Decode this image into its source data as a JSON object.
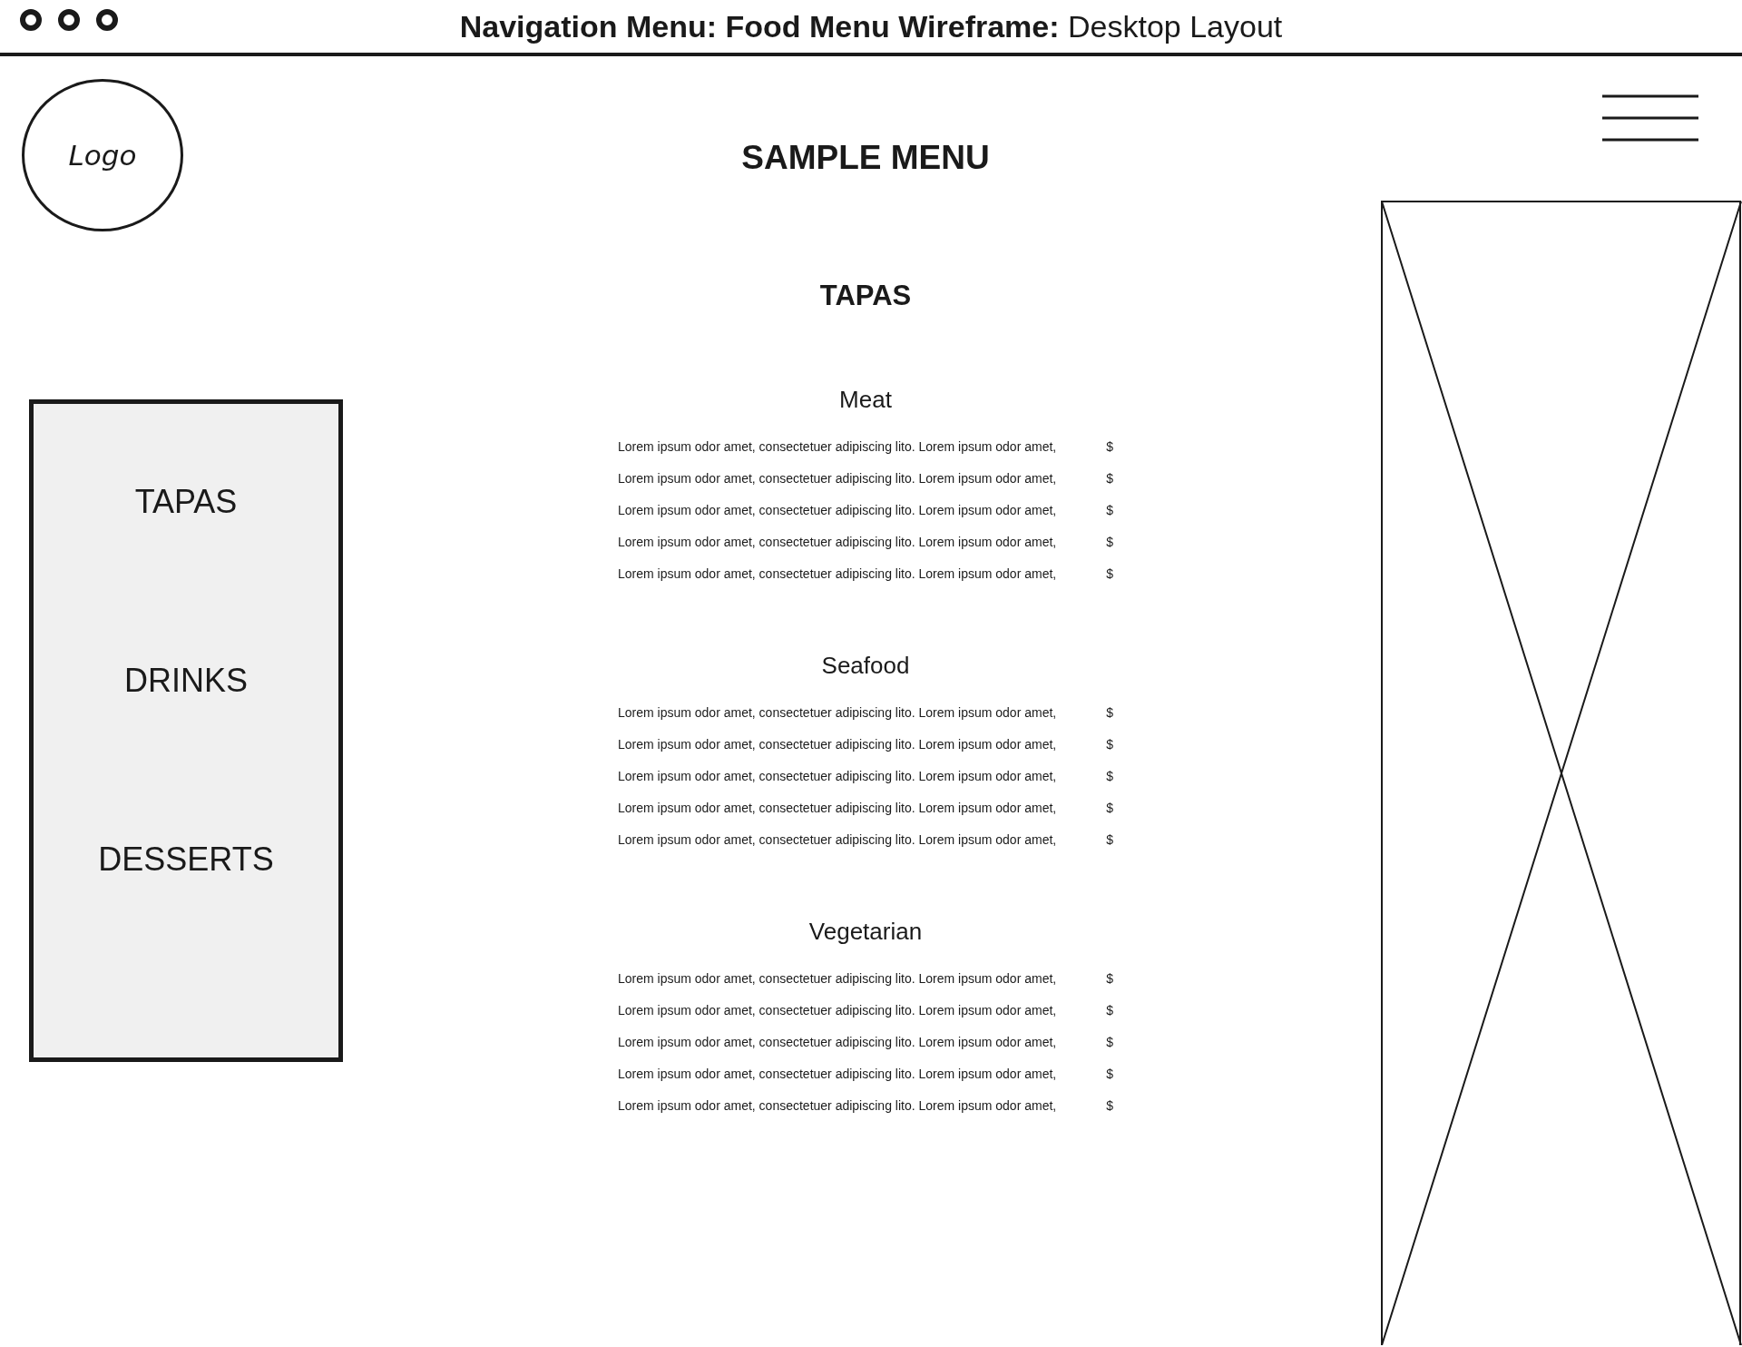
{
  "window": {
    "title": "**Navigation Menu: Food Menu Wireframe:** Desktop Layout"
  },
  "header": {
    "logo": "Logo",
    "heading": "SAMPLE MENU"
  },
  "nav": {
    "items": [
      "TAPAS",
      "DRINKS",
      "DESSERTS"
    ]
  },
  "menu": {
    "title": "TAPAS",
    "sections": [
      {
        "name": "Meat",
        "items": [
          {
            "description": "Lorem ipsum odor amet, consectetuer adipiscing lito. Lorem ipsum odor amet,",
            "price": "$"
          },
          {
            "description": "Lorem ipsum odor amet, consectetuer adipiscing lito. Lorem ipsum odor amet,",
            "price": "$"
          },
          {
            "description": "Lorem ipsum odor amet, consectetuer adipiscing lito. Lorem ipsum odor amet,",
            "price": "$"
          },
          {
            "description": "Lorem ipsum odor amet, consectetuer adipiscing lito. Lorem ipsum odor amet,",
            "price": "$"
          },
          {
            "description": "Lorem ipsum odor amet, consectetuer adipiscing lito. Lorem ipsum odor amet,",
            "price": "$"
          }
        ]
      },
      {
        "name": "Seafood",
        "items": [
          {
            "description": "Lorem ipsum odor amet, consectetuer adipiscing lito. Lorem ipsum odor amet,",
            "price": "$"
          },
          {
            "description": "Lorem ipsum odor amet, consectetuer adipiscing lito. Lorem ipsum odor amet,",
            "price": "$"
          },
          {
            "description": "Lorem ipsum odor amet, consectetuer adipiscing lito. Lorem ipsum odor amet,",
            "price": "$"
          },
          {
            "description": "Lorem ipsum odor amet, consectetuer adipiscing lito. Lorem ipsum odor amet,",
            "price": "$"
          },
          {
            "description": "Lorem ipsum odor amet, consectetuer adipiscing lito. Lorem ipsum odor amet,",
            "price": "$"
          }
        ]
      },
      {
        "name": "Vegetarian",
        "items": [
          {
            "description": "Lorem ipsum odor amet, consectetuer adipiscing lito. Lorem ipsum odor amet,",
            "price": "$"
          },
          {
            "description": "Lorem ipsum odor amet, consectetuer adipiscing lito. Lorem ipsum odor amet,",
            "price": "$"
          },
          {
            "description": "Lorem ipsum odor amet, consectetuer adipiscing lito. Lorem ipsum odor amet,",
            "price": "$"
          },
          {
            "description": "Lorem ipsum odor amet, consectetuer adipiscing lito. Lorem ipsum odor amet,",
            "price": "$"
          },
          {
            "description": "Lorem ipsum odor amet, consectetuer adipiscing lito. Lorem ipsum odor amet,",
            "price": "$"
          }
        ]
      }
    ]
  }
}
